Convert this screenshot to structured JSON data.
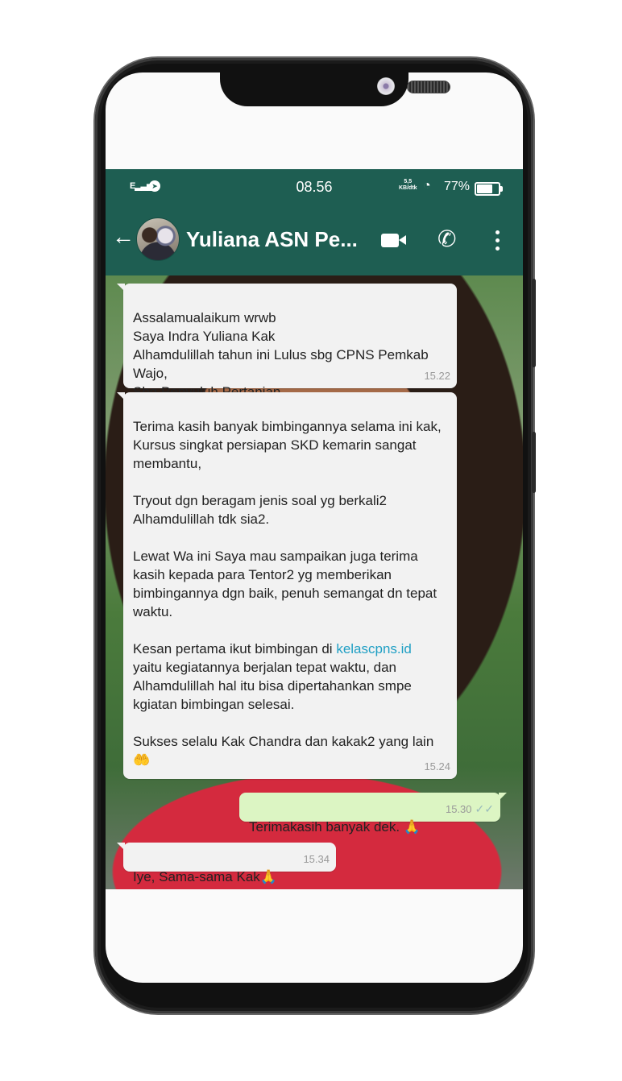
{
  "status_bar": {
    "signal": "E",
    "time": "08.56",
    "net_speed_value": "5,5",
    "net_speed_unit": "KB/dtk",
    "battery": "77%"
  },
  "app_bar": {
    "back_icon": "arrow-left-icon",
    "contact_name": "Yuliana ASN Pe...",
    "icons": [
      "video-call-icon",
      "phone-icon",
      "more-vert-icon"
    ]
  },
  "messages": [
    {
      "direction": "in",
      "text": "Assalamualaikum wrwb\nSaya Indra Yuliana Kak\nAlhamdulillah tahun ini Lulus sbg CPNS Pemkab Wajo,\nSbg Penyuluh Pertanian.",
      "time": "15.22"
    },
    {
      "direction": "in",
      "text_part1": "Terima kasih banyak bimbingannya selama ini kak,\nKursus singkat persiapan SKD kemarin sangat membantu,\n\nTryout dgn beragam jenis soal yg berkali2 Alhamdulillah tdk sia2.\n\nLewat Wa ini Saya mau sampaikan juga terima kasih kepada para Tentor2 yg memberikan bimbingannya dgn baik, penuh semangat dn tepat waktu.\n\nKesan pertama ikut bimbingan di ",
      "link": "kelascpns.id",
      "text_part2": "\nyaitu kegiatannya berjalan tepat waktu, dan Alhamdulillah hal itu bisa dipertahankan smpe kgiatan bimbingan selesai.\n\nSukses selalu Kak Chandra dan kakak2 yang lain\n",
      "emoji": "🤲",
      "time": "15.24"
    },
    {
      "direction": "out",
      "text": "Terimakasih banyak dek. 🙏",
      "time": "15.30",
      "ticks": "✓✓"
    },
    {
      "direction": "in",
      "text": "Iye, Sama-sama Kak🙏",
      "time": "15.34"
    }
  ]
}
